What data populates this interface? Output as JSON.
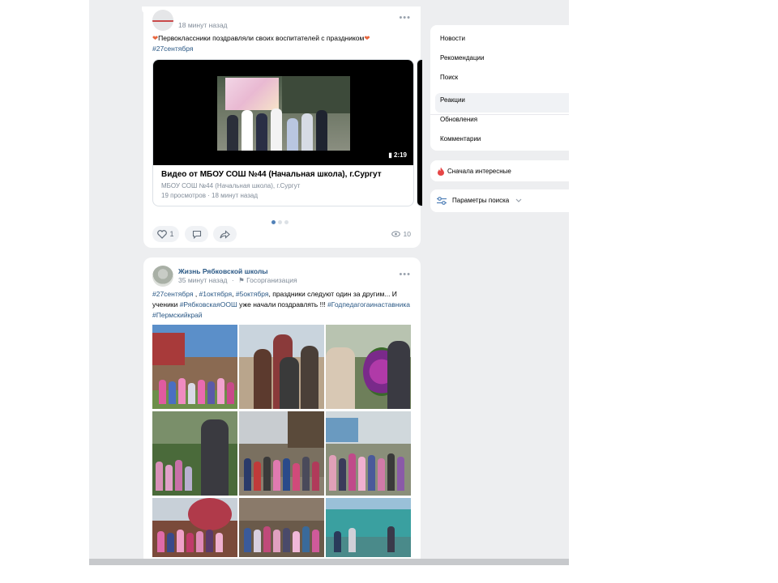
{
  "post1": {
    "time": "18 минут назад",
    "text": "Первоклассники поздравляли своих воспитателей с праздником",
    "heart": "❤",
    "tag": "#27сентября",
    "video": {
      "duration": "2:19",
      "title": "Видео от МБОУ СОШ №44 (Начальная школа), г.Сургут",
      "channel": "МБОУ СОШ №44 (Начальная школа), г.Сургут",
      "views": "19 просмотров",
      "time": "18 минут назад"
    },
    "likes": "1",
    "view_count": "10"
  },
  "post2": {
    "author": "Жизнь Рябковской школы",
    "time": "35 минут назад",
    "org": "Госорганизация",
    "line1_tag1": "#27сентября",
    "line1_sep1": " , ",
    "line1_tag2": "#1октября",
    "line1_sep2": ", ",
    "line1_tag3": "#5октября",
    "line1_text": ", праздники следуют один за другим... И",
    "line2_text1": "ученики ",
    "line2_tag1": "#РябковскаяООШ",
    "line2_text2": " уже начали поздравлять !!! ",
    "line2_tag2": "#Годпедагогаинаставника",
    "line3_tag": "#Пермскийкрай"
  },
  "menu": {
    "items": [
      "Новости",
      "Рекомендации",
      "Поиск",
      "Реакции",
      "Обновления",
      "Комментарии"
    ],
    "active": "Поиск"
  },
  "sort": {
    "label": "Сначала интересные"
  },
  "search_params": {
    "label": "Параметры поиска"
  },
  "colors": {
    "link": "#2a5885",
    "accent": "#5181b8",
    "meta": "#818c99",
    "background": "#edeef0"
  },
  "icons": [
    "heart-icon",
    "comment-icon",
    "share-icon",
    "eye-icon",
    "fire-icon",
    "sliders-icon",
    "chevron-down-icon"
  ]
}
